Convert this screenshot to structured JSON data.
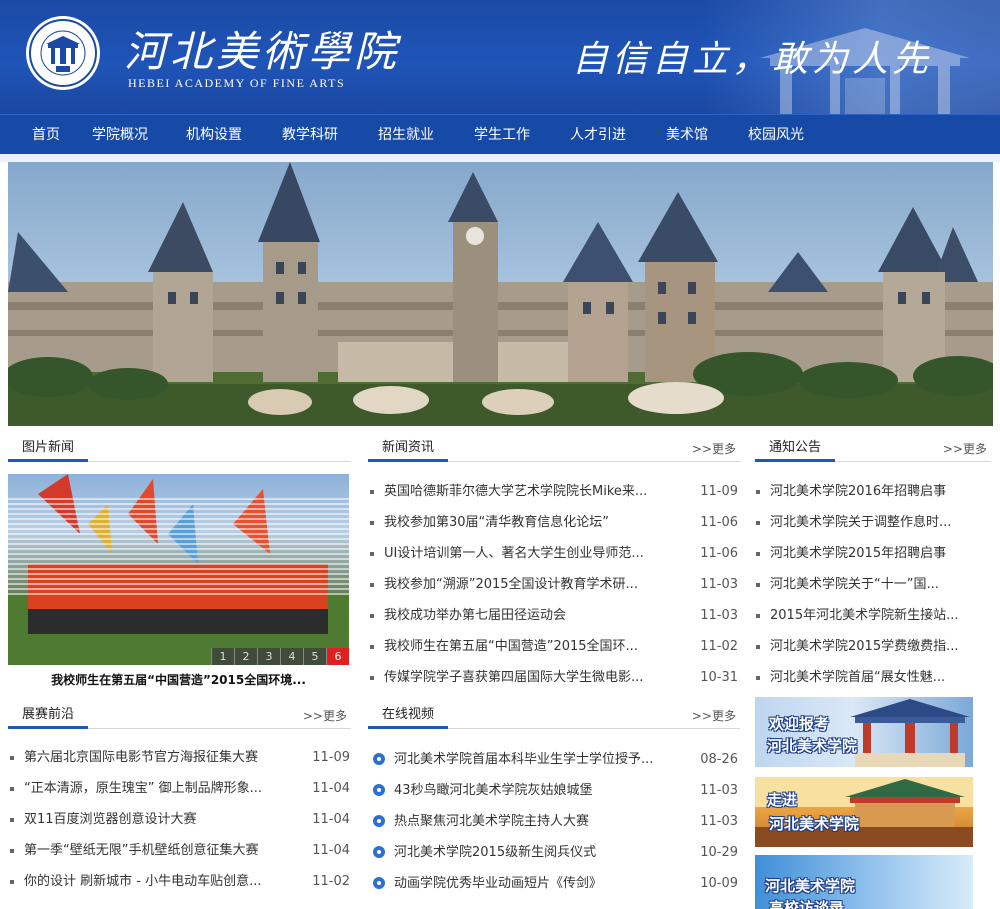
{
  "header": {
    "logo_cn": "河北美術學院",
    "logo_en": "HEBEI ACADEMY OF FINE ARTS",
    "slogan": "自信自立，敢为人先",
    "colors": {
      "primary": "#1b4aa5",
      "nav": "#164aa6",
      "accent_red": "#e02020"
    }
  },
  "nav": {
    "items": [
      "首页",
      "学院概况",
      "机构设置",
      "教学科研",
      "招生就业",
      "学生工作",
      "人才引进",
      "美术馆",
      "校园风光"
    ]
  },
  "photo_news": {
    "title": "图片新闻",
    "caption": "我校师生在第五届“中国营造”2015全国环境...",
    "pages": [
      "1",
      "2",
      "3",
      "4",
      "5",
      "6"
    ],
    "active_page": "6"
  },
  "news": {
    "title": "新闻资讯",
    "more": "更多",
    "items": [
      {
        "text": "英国哈德斯菲尔德大学艺术学院院长Mike来...",
        "date": "11-09"
      },
      {
        "text": "我校参加第30届“清华教育信息化论坛”",
        "date": "11-06"
      },
      {
        "text": "UI设计培训第一人、著名大学生创业导师范...",
        "date": "11-06"
      },
      {
        "text": "我校参加“溯源”2015全国设计教育学术研...",
        "date": "11-03"
      },
      {
        "text": "我校成功举办第七届田径运动会",
        "date": "11-03"
      },
      {
        "text": "我校师生在第五届“中国营造”2015全国环...",
        "date": "11-02"
      },
      {
        "text": "传媒学院学子喜获第四届国际大学生微电影...",
        "date": "10-31"
      }
    ]
  },
  "notices": {
    "title": "通知公告",
    "more": "更多",
    "items": [
      "河北美术学院2016年招聘启事",
      "河北美术学院关于调整作息时...",
      "河北美术学院2015年招聘启事",
      "河北美术学院关于“十一”国...",
      "2015年河北美术学院新生接站...",
      "河北美术学院2015学费缴费指...",
      "河北美术学院首届“展女性魅..."
    ]
  },
  "exhibitions": {
    "title": "展赛前沿",
    "more": "更多",
    "items": [
      {
        "text": "第六届北京国际电影节官方海报征集大赛",
        "date": "11-09"
      },
      {
        "text": "“正本清源，原生瑰宝” 御上制品牌形象...",
        "date": "11-04"
      },
      {
        "text": "双11百度浏览器创意设计大赛",
        "date": "11-04"
      },
      {
        "text": "第一季“壁纸无限”手机壁纸创意征集大赛",
        "date": "11-04"
      },
      {
        "text": "你的设计 刷新城市 - 小牛电动车贴创意...",
        "date": "11-02"
      }
    ]
  },
  "videos": {
    "title": "在线视频",
    "more": "更多",
    "items": [
      {
        "text": "河北美术学院首届本科毕业生学士学位授予...",
        "date": "08-26"
      },
      {
        "text": "43秒鸟瞰河北美术学院灰姑娘城堡",
        "date": "11-03"
      },
      {
        "text": "热点聚焦河北美术学院主持人大赛",
        "date": "11-03"
      },
      {
        "text": "河北美术学院2015级新生阅兵仪式",
        "date": "10-29"
      },
      {
        "text": "动画学院优秀毕业动画短片《传剑》",
        "date": "10-09"
      }
    ]
  },
  "ads": {
    "ad1": [
      "欢迎报考",
      "河北美术学院"
    ],
    "ad2": [
      "走进",
      "河北美术学院"
    ],
    "ad3": [
      "河北美术学院",
      "高校访谈录"
    ]
  }
}
